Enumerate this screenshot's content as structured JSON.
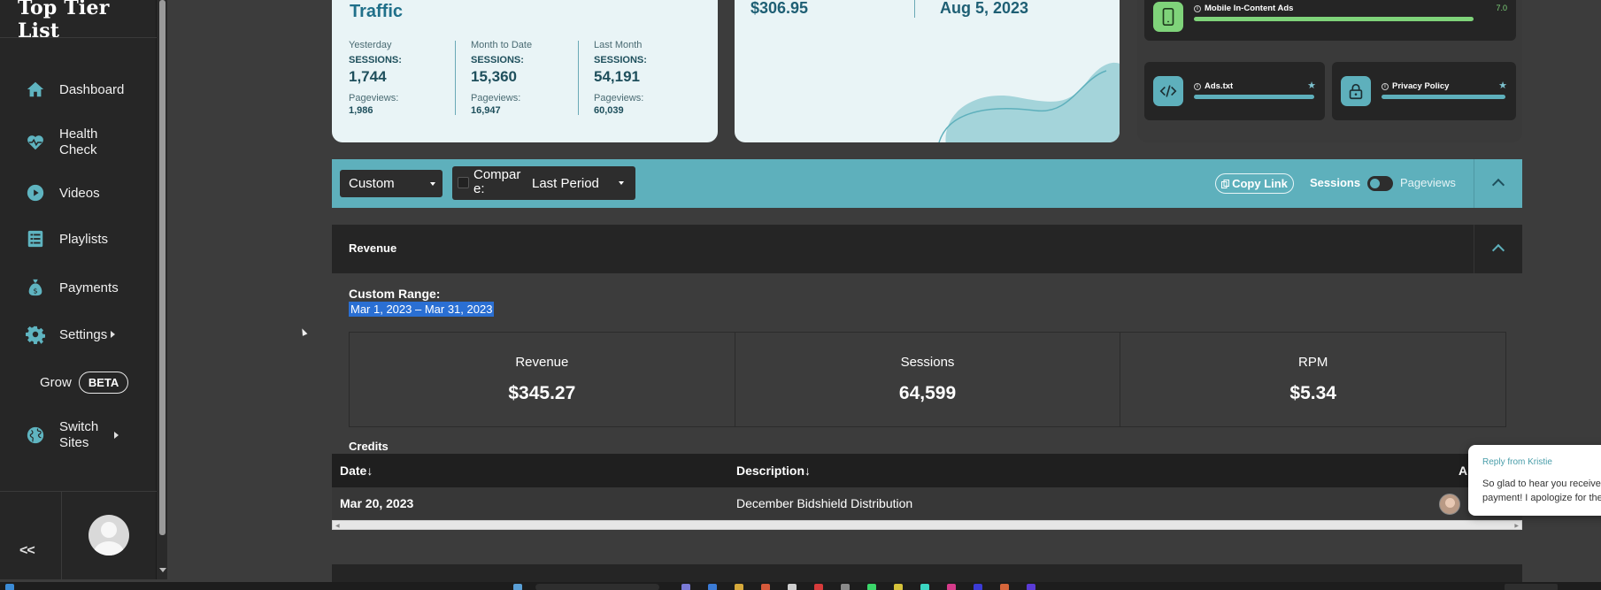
{
  "app": {
    "brand": "Top Tier List"
  },
  "sidebar": {
    "items": [
      {
        "label": "Dashboard",
        "icon": "home-icon"
      },
      {
        "label": "Health\nCheck",
        "icon": "heart-pulse-icon"
      },
      {
        "label": "Videos",
        "icon": "play-circle-icon"
      },
      {
        "label": "Playlists",
        "icon": "list-icon"
      },
      {
        "label": "Payments",
        "icon": "money-bag-icon"
      },
      {
        "label": "Settings",
        "icon": "gear-icon"
      },
      {
        "label": "Switch\nSites",
        "icon": "globe-icon"
      }
    ],
    "grow_label": "Grow",
    "beta_label": "BETA",
    "collapse_label": "<<"
  },
  "traffic_card": {
    "title": "Traffic",
    "columns": [
      {
        "period": "Yesterday",
        "sessions_label": "SESSIONS:",
        "sessions": "1,744",
        "pageviews_label": "Pageviews:",
        "pageviews": "1,986"
      },
      {
        "period": "Month to Date",
        "sessions_label": "SESSIONS:",
        "sessions": "15,360",
        "pageviews_label": "Pageviews:",
        "pageviews": "16,947"
      },
      {
        "period": "Last Month",
        "sessions_label": "SESSIONS:",
        "sessions": "54,191",
        "pageviews_label": "Pageviews:",
        "pageviews": "60,039"
      }
    ]
  },
  "revenue_card": {
    "amount": "$306.95",
    "date": "Aug 5, 2023"
  },
  "health_cards": [
    {
      "title": "Mobile In-Content Ads",
      "score": "7.0",
      "icon": "mobile-icon",
      "icon_bg": "#7fd37a",
      "bar_color": "#7fd37a",
      "bar_fill": 1.0
    },
    {
      "title": "Ads.txt",
      "icon": "code-icon",
      "icon_bg": "#5eb0bc",
      "bar_color": "#5eb0bc",
      "bar_fill": 1.0
    },
    {
      "title": "Privacy Policy",
      "icon": "lock-icon",
      "icon_bg": "#5eb0bc",
      "bar_color": "#5eb0bc",
      "bar_fill": 1.0
    }
  ],
  "toolbar": {
    "range_select": "Custom",
    "compare_label": "Compar e:",
    "compare_select": "Last Period",
    "copy_link": "Copy Link",
    "toggle_left": "Sessions",
    "toggle_right": "Pageviews"
  },
  "revenue_panel": {
    "title": "Revenue",
    "range_label": "Custom Range:",
    "range_value": "Mar 1, 2023 – Mar 31, 2023",
    "stats": [
      {
        "label": "Revenue",
        "value": "$345.27"
      },
      {
        "label": "Sessions",
        "value": "64,599"
      },
      {
        "label": "RPM",
        "value": "$5.34"
      }
    ],
    "credits_label": "Credits",
    "table": {
      "headers": [
        "Date↓",
        "Description↓",
        "A"
      ],
      "rows": [
        {
          "date": "Mar 20, 2023",
          "description": "December Bidshield Distribution"
        }
      ]
    }
  },
  "chat_popup": {
    "from": "Reply from Kristie",
    "message_line1": "So glad to hear you received",
    "message_line2": "payment! I apologize for the"
  },
  "colors": {
    "accent": "#5eb0bc",
    "success": "#7fd37a",
    "selection": "#2a6fd3"
  }
}
